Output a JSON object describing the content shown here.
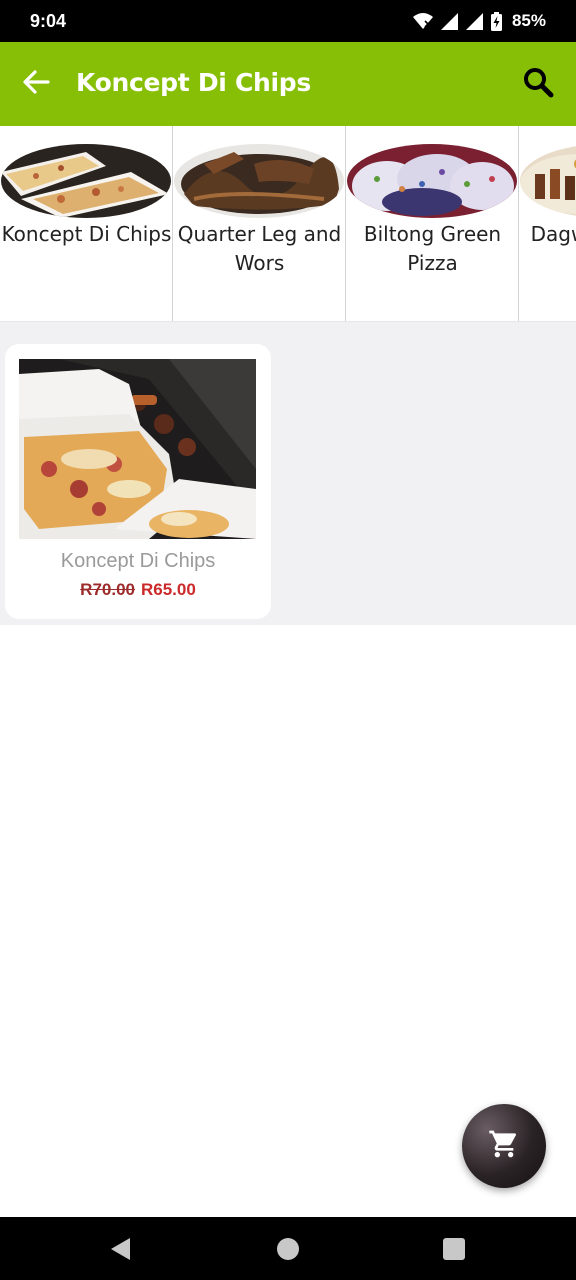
{
  "status_bar": {
    "time": "9:04",
    "battery": "85%",
    "icons": [
      "wifi-icon",
      "signal-icon",
      "signal-icon",
      "battery-charging-icon"
    ]
  },
  "app_bar": {
    "title": "Koncept Di Chips",
    "back_icon": "arrow-left-icon",
    "search_icon": "search-icon",
    "color": "#86bf06"
  },
  "categories": [
    {
      "label": "Koncept Di Chips"
    },
    {
      "label": "Quarter Leg and Wors"
    },
    {
      "label": "Biltong Green Pizza"
    },
    {
      "label": "Dagwood Wors"
    }
  ],
  "products": [
    {
      "name": "Koncept Di Chips",
      "old_price": "R70.00",
      "price": "R65.00"
    }
  ],
  "cart_fab": {
    "icon": "cart-icon"
  },
  "nav_bar": {
    "icons": [
      "nav-back-icon",
      "nav-home-icon",
      "nav-recents-icon"
    ]
  }
}
